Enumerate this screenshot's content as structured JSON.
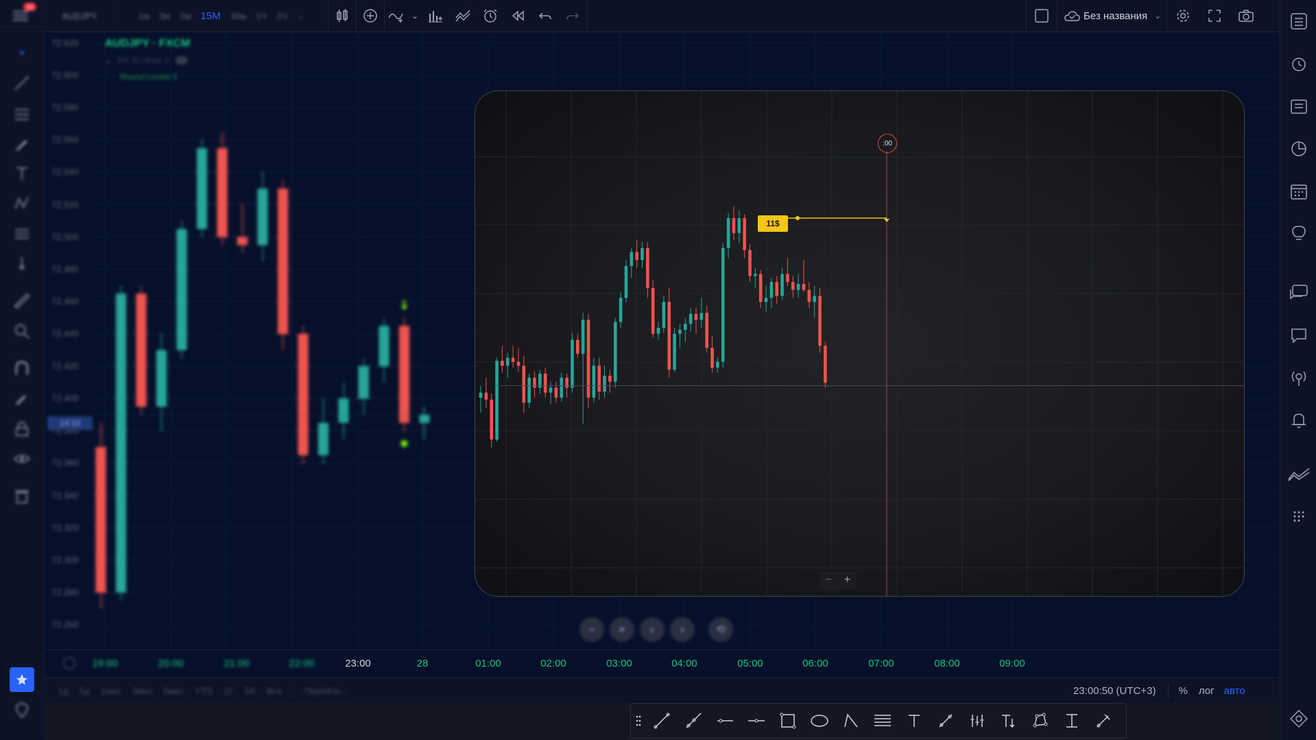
{
  "topbar": {
    "notification_count": "11",
    "symbol": "AUDJPY",
    "timeframes": [
      "1м",
      "3м",
      "5м",
      "15M",
      "30м",
      "1Ч",
      "2Ч"
    ],
    "active_timeframe": "15M",
    "layout_name": "Без названия"
  },
  "legend": {
    "title": "AUDJPY · FXCM",
    "indicator1": "SR 30 close 3",
    "indicator2": "Round Levels 5"
  },
  "price_axis": [
    "72.620",
    "72.600",
    "72.580",
    "72.560",
    "72.540",
    "72.520",
    "72.500",
    "72.480",
    "72.460",
    "72.440",
    "72.420",
    "72.400",
    "72.380",
    "72.360",
    "72.340",
    "72.320",
    "72.300",
    "72.280",
    "72.260"
  ],
  "current_price_badge": "14:10",
  "time_axis": [
    "19:00",
    "20:00",
    "21:00",
    "22:00",
    "23:00",
    "28",
    "01:00",
    "02:00",
    "03:00",
    "04:00",
    "05:00",
    "06:00",
    "07:00",
    "08:00",
    "09:00"
  ],
  "bottom": {
    "ranges": [
      "1д",
      "5д",
      "1мес",
      "3мес",
      "6мес",
      "YTD",
      "1Г",
      "5Л",
      "Все"
    ],
    "goto": "Перейти...",
    "clock": "23:00:50 (UTC+3)",
    "percent": "%",
    "log": "лог",
    "auto": "авто"
  },
  "popup": {
    "time_marker": ":00",
    "level_label": "11$"
  },
  "colors": {
    "bull": "#26a69a",
    "bear": "#ef5350",
    "accent": "#2962ff",
    "time_green": "#19c37d",
    "label_yellow": "#f5c518"
  },
  "chart_data": {
    "type": "candlestick",
    "series": [
      {
        "name": "main",
        "ohlc": [
          [
            72.37,
            72.385,
            72.27,
            72.28
          ],
          [
            72.28,
            72.47,
            72.275,
            72.465
          ],
          [
            72.465,
            72.47,
            72.39,
            72.395
          ],
          [
            72.395,
            72.44,
            72.38,
            72.43
          ],
          [
            72.43,
            72.51,
            72.425,
            72.505
          ],
          [
            72.505,
            72.56,
            72.5,
            72.555
          ],
          [
            72.555,
            72.565,
            72.495,
            72.5
          ],
          [
            72.5,
            72.52,
            72.49,
            72.495
          ],
          [
            72.495,
            72.54,
            72.485,
            72.53
          ],
          [
            72.53,
            72.535,
            72.43,
            72.44
          ],
          [
            72.44,
            72.445,
            72.36,
            72.365
          ],
          [
            72.365,
            72.4,
            72.36,
            72.385
          ],
          [
            72.385,
            72.41,
            72.375,
            72.4
          ],
          [
            72.4,
            72.425,
            72.39,
            72.42
          ],
          [
            72.42,
            72.45,
            72.41,
            72.445
          ],
          [
            72.445,
            72.45,
            72.38,
            72.385
          ],
          [
            72.385,
            72.395,
            72.375,
            72.39
          ]
        ]
      },
      {
        "name": "popup",
        "ohlc": [
          [
            72.34,
            72.352,
            72.325,
            72.345
          ],
          [
            72.345,
            72.36,
            72.33,
            72.338
          ],
          [
            72.338,
            72.344,
            72.29,
            72.298
          ],
          [
            72.298,
            72.38,
            72.296,
            72.377
          ],
          [
            72.377,
            72.392,
            72.365,
            72.372
          ],
          [
            72.372,
            72.385,
            72.36,
            72.38
          ],
          [
            72.38,
            72.392,
            72.37,
            72.376
          ],
          [
            72.376,
            72.39,
            72.366,
            72.372
          ],
          [
            72.372,
            72.382,
            72.325,
            72.335
          ],
          [
            72.335,
            72.364,
            72.33,
            72.36
          ],
          [
            72.36,
            72.366,
            72.34,
            72.35
          ],
          [
            72.35,
            72.368,
            72.344,
            72.364
          ],
          [
            72.364,
            72.37,
            72.34,
            72.345
          ],
          [
            72.345,
            72.356,
            72.334,
            72.35
          ],
          [
            72.35,
            72.356,
            72.335,
            72.34
          ],
          [
            72.34,
            72.365,
            72.336,
            72.36
          ],
          [
            72.36,
            72.364,
            72.34,
            72.35
          ],
          [
            72.35,
            72.405,
            72.345,
            72.398
          ],
          [
            72.398,
            72.404,
            72.38,
            72.384
          ],
          [
            72.384,
            72.425,
            72.314,
            72.418
          ],
          [
            72.418,
            72.424,
            72.33,
            72.34
          ],
          [
            72.34,
            72.38,
            72.335,
            72.372
          ],
          [
            72.372,
            72.38,
            72.338,
            72.346
          ],
          [
            72.346,
            72.372,
            72.34,
            72.362
          ],
          [
            72.362,
            72.368,
            72.345,
            72.356
          ],
          [
            72.356,
            72.42,
            72.35,
            72.416
          ],
          [
            72.416,
            72.446,
            72.41,
            72.44
          ],
          [
            72.44,
            72.478,
            72.436,
            72.472
          ],
          [
            72.472,
            72.49,
            72.46,
            72.486
          ],
          [
            72.486,
            72.498,
            72.47,
            72.478
          ],
          [
            72.478,
            72.496,
            72.47,
            72.49
          ],
          [
            72.49,
            72.496,
            72.44,
            72.45
          ],
          [
            72.45,
            72.458,
            72.4,
            72.404
          ],
          [
            72.404,
            72.416,
            72.398,
            72.41
          ],
          [
            72.41,
            72.442,
            72.405,
            72.436
          ],
          [
            72.436,
            72.45,
            72.36,
            72.368
          ],
          [
            72.368,
            72.41,
            72.366,
            72.404
          ],
          [
            72.404,
            72.414,
            72.39,
            72.408
          ],
          [
            72.408,
            72.42,
            72.396,
            72.414
          ],
          [
            72.414,
            72.43,
            72.406,
            72.424
          ],
          [
            72.424,
            72.43,
            72.404,
            72.418
          ],
          [
            72.418,
            72.44,
            72.41,
            72.425
          ],
          [
            72.425,
            72.432,
            72.385,
            72.39
          ],
          [
            72.39,
            72.402,
            72.365,
            72.37
          ],
          [
            72.37,
            72.38,
            72.365,
            72.376
          ],
          [
            72.376,
            72.495,
            72.37,
            72.49
          ],
          [
            72.49,
            72.525,
            72.48,
            72.52
          ],
          [
            72.52,
            72.532,
            72.498,
            72.505
          ],
          [
            72.505,
            72.528,
            72.495,
            72.52
          ],
          [
            72.52,
            72.524,
            72.48,
            72.488
          ],
          [
            72.488,
            72.494,
            72.456,
            72.462
          ],
          [
            72.462,
            72.47,
            72.45,
            72.464
          ],
          [
            72.464,
            72.468,
            72.43,
            72.436
          ],
          [
            72.436,
            72.452,
            72.426,
            72.44
          ],
          [
            72.44,
            72.46,
            72.43,
            72.456
          ],
          [
            72.456,
            72.462,
            72.434,
            72.442
          ],
          [
            72.442,
            72.47,
            72.438,
            72.464
          ],
          [
            72.464,
            72.48,
            72.452,
            72.456
          ],
          [
            72.456,
            72.462,
            72.44,
            72.448
          ],
          [
            72.448,
            72.464,
            72.44,
            72.454
          ],
          [
            72.454,
            72.478,
            72.446,
            72.448
          ],
          [
            72.448,
            72.456,
            72.43,
            72.436
          ],
          [
            72.436,
            72.452,
            72.42,
            72.442
          ],
          [
            72.442,
            72.45,
            72.385,
            72.392
          ],
          [
            72.392,
            72.396,
            72.35,
            72.355
          ]
        ]
      }
    ]
  }
}
